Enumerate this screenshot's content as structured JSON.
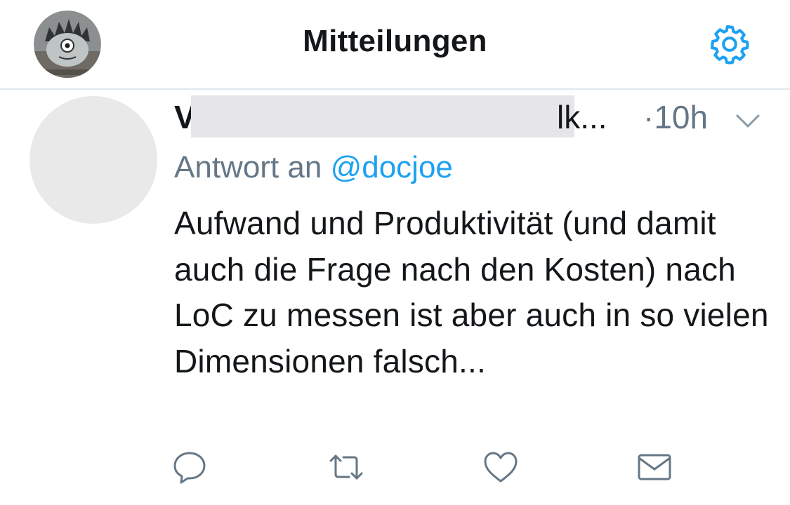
{
  "header": {
    "title": "Mitteilungen",
    "avatar_icon": "user-avatar-monster",
    "settings_icon": "gear-icon"
  },
  "tweet": {
    "author_visible_start": "V",
    "author_visible_end": "lk...",
    "time": "·10h",
    "reply_prefix": "Antwort an",
    "reply_handle": "@docjoe",
    "text": "Aufwand und Produktivität (und damit auch die Frage nach den Kosten) nach LoC zu messen ist aber auch in so vielen Dimensionen falsch...",
    "actions": [
      "reply-icon",
      "retweet-icon",
      "like-icon",
      "message-icon"
    ]
  },
  "colors": {
    "accent": "#1da1f2",
    "secondary_text": "#657786",
    "primary_text": "#14171a",
    "divider": "#e1e8ed"
  }
}
